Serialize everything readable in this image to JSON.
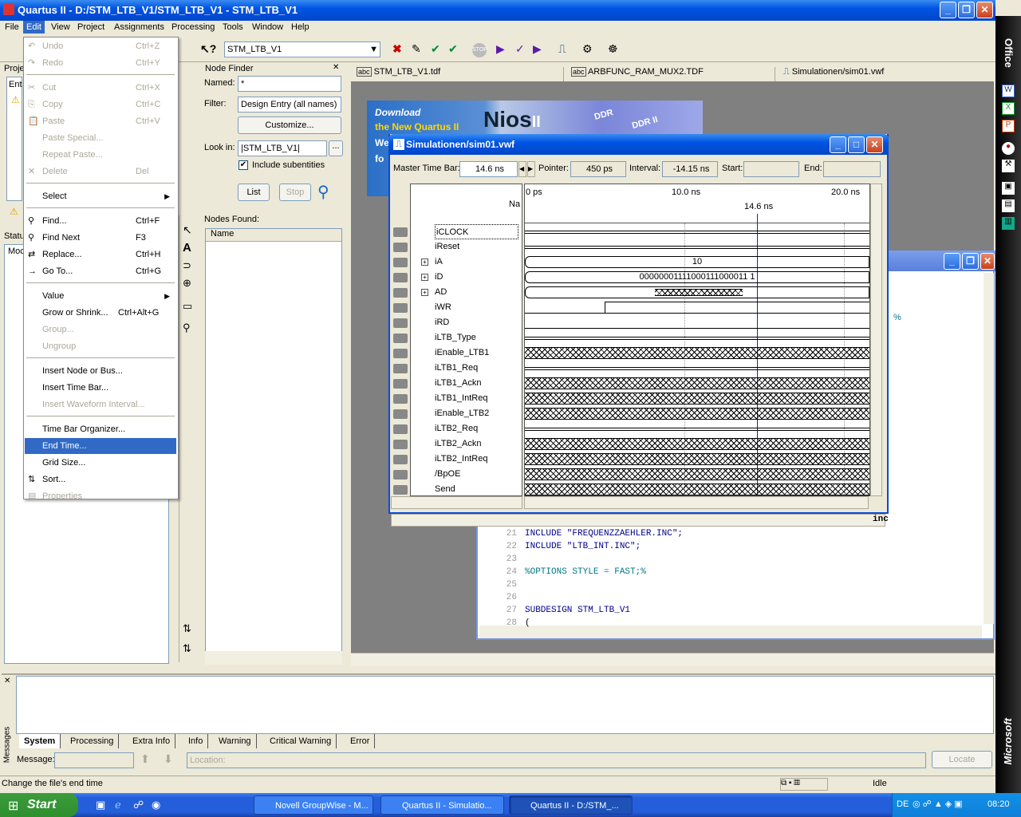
{
  "window": {
    "title": "Quartus II - D:/STM_LTB_V1/STM_LTB_V1 - STM_LTB_V1"
  },
  "menubar": [
    "File",
    "Edit",
    "View",
    "Project",
    "Assignments",
    "Processing",
    "Tools",
    "Window",
    "Help"
  ],
  "toolbar": {
    "project_combo": "STM_LTB_V1"
  },
  "edit_menu": {
    "items": [
      {
        "label": "Undo",
        "shortcut": "Ctrl+Z",
        "disabled": true
      },
      {
        "label": "Redo",
        "shortcut": "Ctrl+Y",
        "disabled": true
      },
      {
        "label": "Cut",
        "shortcut": "Ctrl+X",
        "disabled": true
      },
      {
        "label": "Copy",
        "shortcut": "Ctrl+C",
        "disabled": true
      },
      {
        "label": "Paste",
        "shortcut": "Ctrl+V",
        "disabled": true
      },
      {
        "label": "Paste Special...",
        "shortcut": "",
        "disabled": true
      },
      {
        "label": "Repeat Paste...",
        "shortcut": "",
        "disabled": true
      },
      {
        "label": "Delete",
        "shortcut": "Del",
        "disabled": true
      },
      {
        "label": "Select",
        "shortcut": "",
        "disabled": false
      },
      {
        "label": "Find...",
        "shortcut": "Ctrl+F",
        "disabled": false
      },
      {
        "label": "Find Next",
        "shortcut": "F3",
        "disabled": false
      },
      {
        "label": "Replace...",
        "shortcut": "Ctrl+H",
        "disabled": false
      },
      {
        "label": "Go To...",
        "shortcut": "Ctrl+G",
        "disabled": false
      },
      {
        "label": "Value",
        "shortcut": "",
        "disabled": false
      },
      {
        "label": "Grow or Shrink...",
        "shortcut": "Ctrl+Alt+G",
        "disabled": false
      },
      {
        "label": "Group...",
        "shortcut": "",
        "disabled": true
      },
      {
        "label": "Ungroup",
        "shortcut": "",
        "disabled": true
      },
      {
        "label": "Insert Node or Bus...",
        "shortcut": "",
        "disabled": false
      },
      {
        "label": "Insert Time Bar...",
        "shortcut": "",
        "disabled": false
      },
      {
        "label": "Insert Waveform Interval...",
        "shortcut": "",
        "disabled": true
      },
      {
        "label": "Time Bar Organizer...",
        "shortcut": "",
        "disabled": false
      },
      {
        "label": "End Time...",
        "shortcut": "",
        "disabled": false
      },
      {
        "label": "Grid Size...",
        "shortcut": "",
        "disabled": false
      },
      {
        "label": "Sort...",
        "shortcut": "",
        "disabled": false
      },
      {
        "label": "Properties",
        "shortcut": "",
        "disabled": true
      }
    ]
  },
  "left_panel": {
    "project_label": "Proje",
    "ent_label": "Ent",
    "status_label": "Statu",
    "mod_label": "Moc"
  },
  "node_finder": {
    "title": "Node Finder",
    "named_label": "Named:",
    "named_value": "*",
    "filter_label": "Filter:",
    "filter_value": "Design Entry (all names)",
    "customize_label": "Customize...",
    "lookin_label": "Look in:",
    "lookin_value": "|STM_LTB_V1|",
    "include_sub": "Include subentities",
    "list_label": "List",
    "stop_label": "Stop",
    "nodes_found": "Nodes Found:",
    "name_col": "Name"
  },
  "doc_tabs": [
    "STM_LTB_V1.tdf",
    "ARBFUNC_RAM_MUX2.TDF",
    "Simulationen/sim01.vwf"
  ],
  "banner": {
    "line1": "Download",
    "line2": "the New Quartus II",
    "line3": "We",
    "line4": "fo",
    "brand": "Nios",
    "brand_sup": "II",
    "ddr1": "DDR",
    "ddr2": "DDR II"
  },
  "sim": {
    "title": "Simulationen/sim01.vwf",
    "master_label": "Master Time Bar:",
    "master_value": "14.6 ns",
    "pointer_label": "Pointer:",
    "pointer_value": "450 ps",
    "interval_label": "Interval:",
    "interval_value": "-14.15 ns",
    "start_label": "Start:",
    "end_label": "End:",
    "name_col": "Na",
    "ticks": [
      "0 ps",
      "10.0 ns",
      "20.0 ns"
    ],
    "cursor_label": "14.6 ns",
    "signals": [
      "iCLOCK",
      "iReset",
      "iA",
      "iD",
      "AD",
      "iWR",
      "iRD",
      "iLTB_Type",
      "iEnable_LTB1",
      "iLTB1_Req",
      "iLTB1_Ackn",
      "iLTB1_IntReq",
      "iEnable_LTB2",
      "iLTB2_Req",
      "iLTB2_Ackn",
      "iLTB2_IntReq",
      "/BpOE",
      "Send"
    ],
    "bus_iA": "10",
    "bus_iD": "00000001111000111000011 1",
    "inc_label": "inc"
  },
  "code": {
    "lines": [
      {
        "n": "21",
        "t": "INCLUDE \"FREQUENZZAEHLER.INC\";"
      },
      {
        "n": "22",
        "t": "INCLUDE \"LTB_INT.INC\";"
      },
      {
        "n": "23",
        "t": ""
      },
      {
        "n": "24",
        "t": "%OPTIONS STYLE = FAST;%"
      },
      {
        "n": "25",
        "t": ""
      },
      {
        "n": "26",
        "t": ""
      },
      {
        "n": "27",
        "t": "SUBDESIGN STM_LTB_V1"
      },
      {
        "n": "28",
        "t": "("
      }
    ],
    "pct": "%"
  },
  "messages": {
    "tabs": [
      "System",
      "Processing",
      "Extra Info",
      "Info",
      "Warning",
      "Critical Warning",
      "Error"
    ],
    "side_label": "Messages",
    "message_label": "Message:",
    "location_placeholder": "Location:",
    "locate_label": "Locate"
  },
  "statusbar": {
    "text": "Change the file's end time",
    "state": "Idle"
  },
  "taskbar": {
    "start": "Start",
    "tasks": [
      "Novell GroupWise - M...",
      "Quartus II - Simulatio...",
      "Quartus II - D:/STM_..."
    ],
    "lang": "DE",
    "clock": "08:20"
  },
  "office_bar": {
    "top": "Office",
    "bottom": "Microsoft"
  }
}
